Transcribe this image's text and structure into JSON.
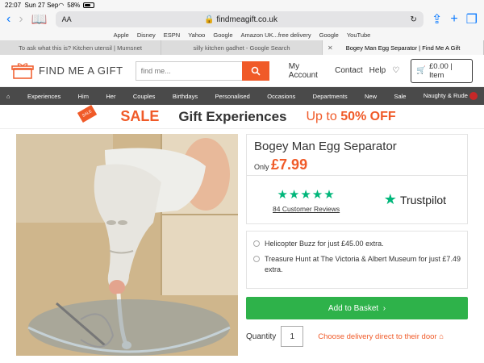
{
  "status": {
    "time": "22:07",
    "date": "Sun 27 Sep",
    "battery": "58%"
  },
  "browser": {
    "url": "findmeagift.co.uk",
    "aa": "AA"
  },
  "favorites": [
    "Apple",
    "Disney",
    "ESPN",
    "Yahoo",
    "Google",
    "Amazon UK...free delivery",
    "Google",
    "YouTube"
  ],
  "tabs": [
    {
      "label": "To ask what this is? Kitchen utensil | Mumsnet"
    },
    {
      "label": "silly kitchen gadhet - Google Search"
    },
    {
      "label": "Bogey Man Egg Separator | Find Me A Gift"
    }
  ],
  "site": {
    "logo_text": "FIND ME A GIFT",
    "search_placeholder": "find me...",
    "my_account": "My Account",
    "contact": "Contact",
    "help": "Help",
    "basket": "£0.00 | Item"
  },
  "nav": [
    "Experiences",
    "Him",
    "Her",
    "Couples",
    "Birthdays",
    "Personalised",
    "Occasions",
    "Departments",
    "New",
    "Sale",
    "Naughty & Rude"
  ],
  "banner": {
    "tag": "SALE",
    "sale": "SALE",
    "gift": "Gift Experiences",
    "upto": "Up to",
    "upto_value": "50% OFF"
  },
  "product": {
    "title": "Bogey Man Egg Separator",
    "only": "Only",
    "price": "£7.99",
    "stars": "★★★★★",
    "reviews": "84 Customer Reviews",
    "trustpilot": "Trustpilot",
    "extra1": "Helicopter Buzz for just £45.00 extra.",
    "extra2": "Treasure Hunt at The Victoria & Albert Museum for just £7.49 extra.",
    "add_label": "Add to Basket",
    "qty_label": "Quantity",
    "qty_value": "1",
    "delivery": "Choose delivery direct to their door"
  }
}
